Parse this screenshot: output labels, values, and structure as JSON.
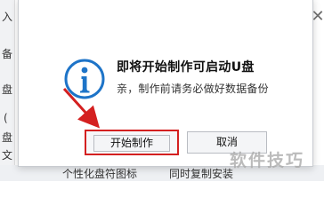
{
  "dialog": {
    "title": "即将开始制作可启动U盘",
    "message": "亲，制作前请务必做好数据备份",
    "confirm_label": "开始制作",
    "cancel_label": "取消",
    "close_glyph": "✕"
  },
  "background": {
    "left_fragments": [
      "入",
      "备",
      "盘",
      "(",
      "盘",
      "文"
    ],
    "bottom_fragments": [
      "个性化盘符图标",
      "同时复制安装"
    ]
  },
  "annotation": {
    "arrow_color": "#d42020",
    "highlight_color": "#d42020"
  },
  "watermark": "软件技巧",
  "icons": {
    "info": "info-icon",
    "close": "close-icon"
  },
  "colors": {
    "info_circle": "#1e74c8",
    "accent_red": "#d42020"
  }
}
